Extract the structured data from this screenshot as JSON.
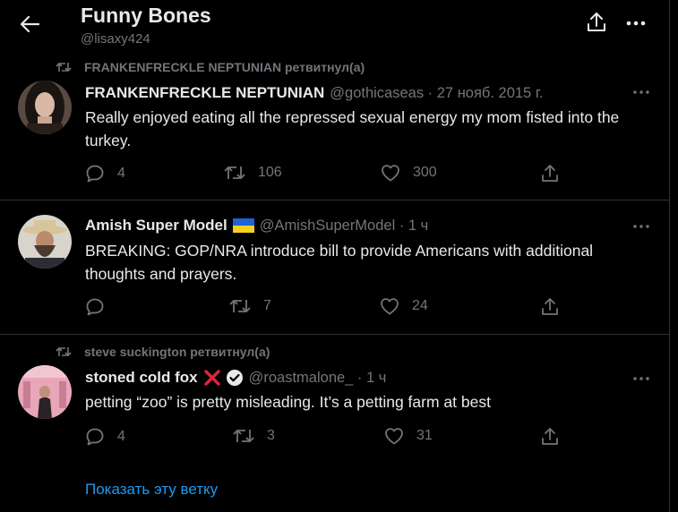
{
  "header": {
    "title": "Funny Bones",
    "handle": "@lisaxy424"
  },
  "tweets": [
    {
      "retweeted_by": "FRANKENFRECKLE NEPTUNIAN ретвитнул(а)",
      "author": "FRANKENFRECKLE NEPTUNIAN",
      "meta": "@gothicaseas · 27 нояб. 2015 г.",
      "text": "Really enjoyed eating all the repressed sexual energy my mom fisted into the turkey.",
      "replies": "4",
      "retweets": "106",
      "likes": "300"
    },
    {
      "retweeted_by": "",
      "author": "Amish Super Model",
      "meta": "@AmishSuperModel · 1 ч",
      "text": "BREAKING: GOP/NRA introduce bill to provide Americans with additional thoughts and prayers.",
      "replies": "",
      "retweets": "7",
      "likes": "24"
    },
    {
      "retweeted_by": "steve suckington ретвитнул(а)",
      "author": "stoned cold fox",
      "meta": "@roastmalone_ · 1 ч",
      "text": "petting “zoo” is pretty misleading. It’s a petting farm at best",
      "replies": "4",
      "retweets": "3",
      "likes": "31"
    }
  ],
  "show_thread": "Показать эту ветку",
  "colors": {
    "background": "#000000",
    "text": "#e7e9ea",
    "secondary": "#71767b",
    "accent": "#1d9bf0",
    "divider": "#2f3336"
  },
  "icons": [
    "back-arrow-icon",
    "share-icon",
    "more-icon",
    "retweet-icon",
    "reply-icon",
    "like-icon",
    "ukraine-flag-icon",
    "cross-mark-icon",
    "verified-icon"
  ]
}
